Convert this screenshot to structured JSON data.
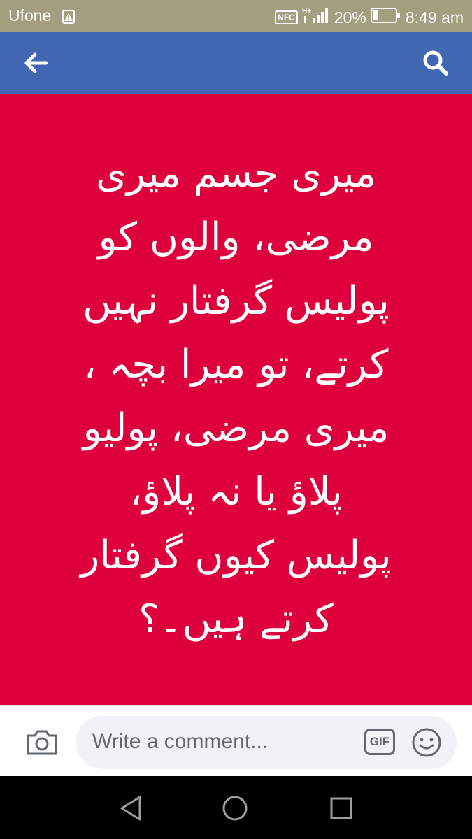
{
  "status_bar": {
    "carrier": "Ufone",
    "nfc": "NFC",
    "network": "H+",
    "battery_percent": "20%",
    "battery_level": 0.2,
    "time": "8:49 am"
  },
  "app_bar": {
    "back_icon": "arrow-left-icon",
    "search_icon": "search-icon",
    "color": "#4267b2"
  },
  "post": {
    "background_color": "#dd003c",
    "text_color": "#ffffff",
    "lines": [
      "میری جسم میری",
      "مرضی، والوں کو",
      "پولیس گرفتار نہیں",
      "کرتے، تو میرا بچہ ،",
      "میری مرضی، پولیو",
      "پلاؤ یا نہ پلاؤ،",
      "پولیس کیوں گرفتار",
      "کرتے ہیں۔؟"
    ]
  },
  "comment_bar": {
    "camera_icon": "camera-icon",
    "placeholder": "Write a comment...",
    "gif_label": "GIF",
    "emoji_icon": "smiley-icon"
  },
  "nav_bar": {
    "back_icon": "triangle-back-icon",
    "home_icon": "circle-home-icon",
    "recent_icon": "square-recents-icon"
  }
}
